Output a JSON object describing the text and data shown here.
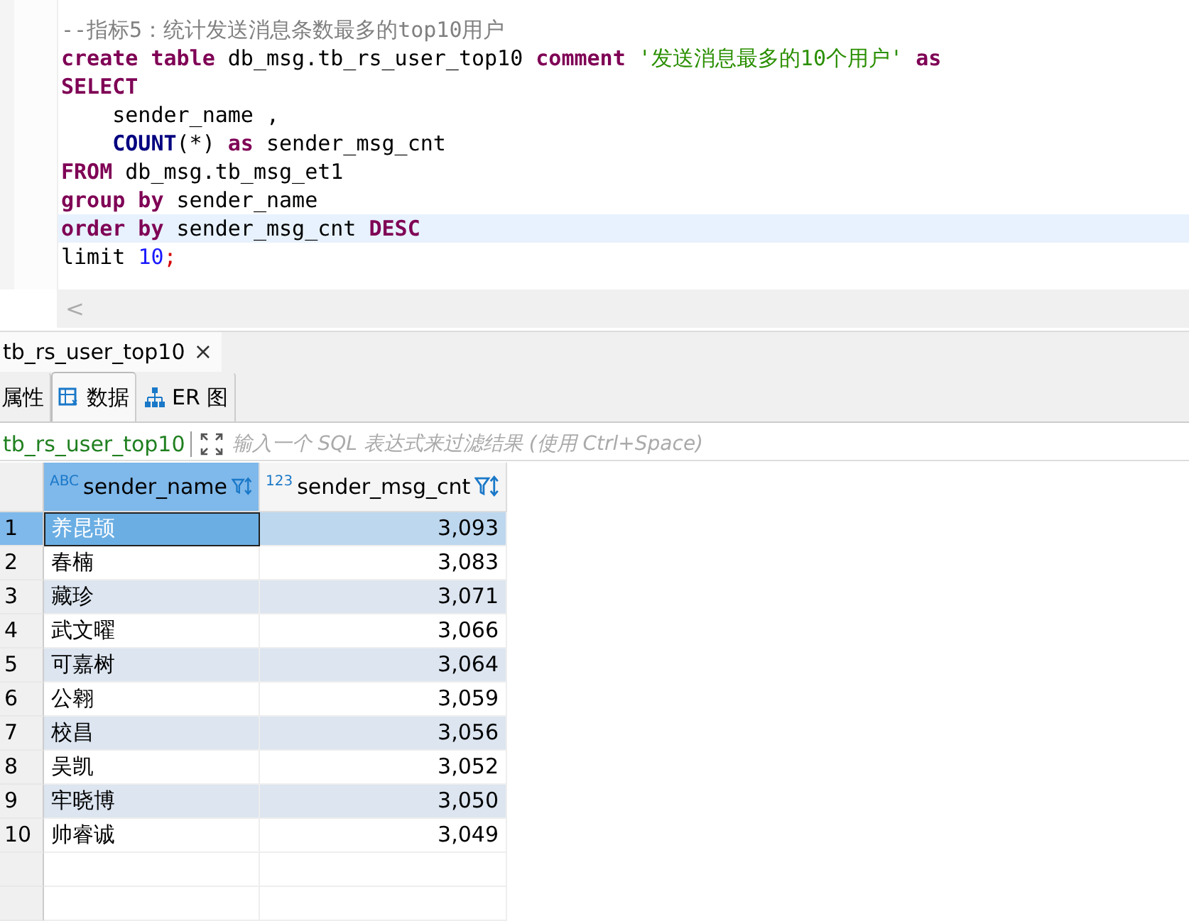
{
  "editor": {
    "lines": [
      {
        "current": false,
        "tokens": [
          {
            "kind": "comment",
            "text": "--指标5：统计发送消息条数最多的top10用户"
          }
        ]
      },
      {
        "current": false,
        "tokens": [
          {
            "kind": "keyword",
            "text": "create table"
          },
          {
            "kind": "plain",
            "text": " db_msg.tb_rs_user_top10 "
          },
          {
            "kind": "keyword",
            "text": "comment"
          },
          {
            "kind": "string",
            "text": " '发送消息最多的10个用户' "
          },
          {
            "kind": "keyword",
            "text": "as"
          }
        ]
      },
      {
        "current": false,
        "tokens": [
          {
            "kind": "keyword",
            "text": "SELECT"
          }
        ]
      },
      {
        "current": false,
        "tokens": [
          {
            "kind": "plain",
            "text": "    sender_name ,"
          }
        ]
      },
      {
        "current": false,
        "tokens": [
          {
            "kind": "function",
            "text": "    COUNT"
          },
          {
            "kind": "plain",
            "text": "(*) "
          },
          {
            "kind": "keyword",
            "text": "as"
          },
          {
            "kind": "plain",
            "text": " sender_msg_cnt"
          }
        ]
      },
      {
        "current": false,
        "tokens": [
          {
            "kind": "keyword",
            "text": "FROM"
          },
          {
            "kind": "plain",
            "text": " db_msg.tb_msg_et1"
          }
        ]
      },
      {
        "current": false,
        "tokens": [
          {
            "kind": "keyword",
            "text": "group by"
          },
          {
            "kind": "plain",
            "text": " sender_name"
          }
        ]
      },
      {
        "current": true,
        "tokens": [
          {
            "kind": "keyword",
            "text": "order by"
          },
          {
            "kind": "plain",
            "text": " sender_msg_cnt "
          },
          {
            "kind": "keyword",
            "text": "DESC"
          }
        ]
      },
      {
        "current": false,
        "tokens": [
          {
            "kind": "plain",
            "text": "limit "
          },
          {
            "kind": "number",
            "text": "10"
          },
          {
            "kind": "punct",
            "text": ";"
          }
        ]
      }
    ],
    "scroll_left": "<"
  },
  "result_tab": {
    "title": "tb_rs_user_top10",
    "close": "×"
  },
  "views": [
    {
      "label": "属性",
      "selected": false
    },
    {
      "label": "数据",
      "selected": true
    },
    {
      "label": "ER 图",
      "selected": false
    }
  ],
  "filter": {
    "table": "tb_rs_user_top10",
    "placeholder": "输入一个 SQL 表达式来过滤结果 (使用 Ctrl+Space)"
  },
  "grid": {
    "columns": [
      {
        "type": "ABC",
        "name": "sender_name"
      },
      {
        "type": "123",
        "name": "sender_msg_cnt"
      }
    ],
    "rows": [
      {
        "n": "1",
        "name": "养昆颉",
        "cnt": "3,093",
        "selected": true
      },
      {
        "n": "2",
        "name": "春楠",
        "cnt": "3,083",
        "selected": false
      },
      {
        "n": "3",
        "name": "藏珍",
        "cnt": "3,071",
        "selected": false
      },
      {
        "n": "4",
        "name": "武文曜",
        "cnt": "3,066",
        "selected": false
      },
      {
        "n": "5",
        "name": "可嘉树",
        "cnt": "3,064",
        "selected": false
      },
      {
        "n": "6",
        "name": "公翱",
        "cnt": "3,059",
        "selected": false
      },
      {
        "n": "7",
        "name": "校昌",
        "cnt": "3,056",
        "selected": false
      },
      {
        "n": "8",
        "name": "吴凯",
        "cnt": "3,052",
        "selected": false
      },
      {
        "n": "9",
        "name": "牢晓博",
        "cnt": "3,050",
        "selected": false
      },
      {
        "n": "10",
        "name": "帅睿诚",
        "cnt": "3,049",
        "selected": false
      }
    ]
  }
}
